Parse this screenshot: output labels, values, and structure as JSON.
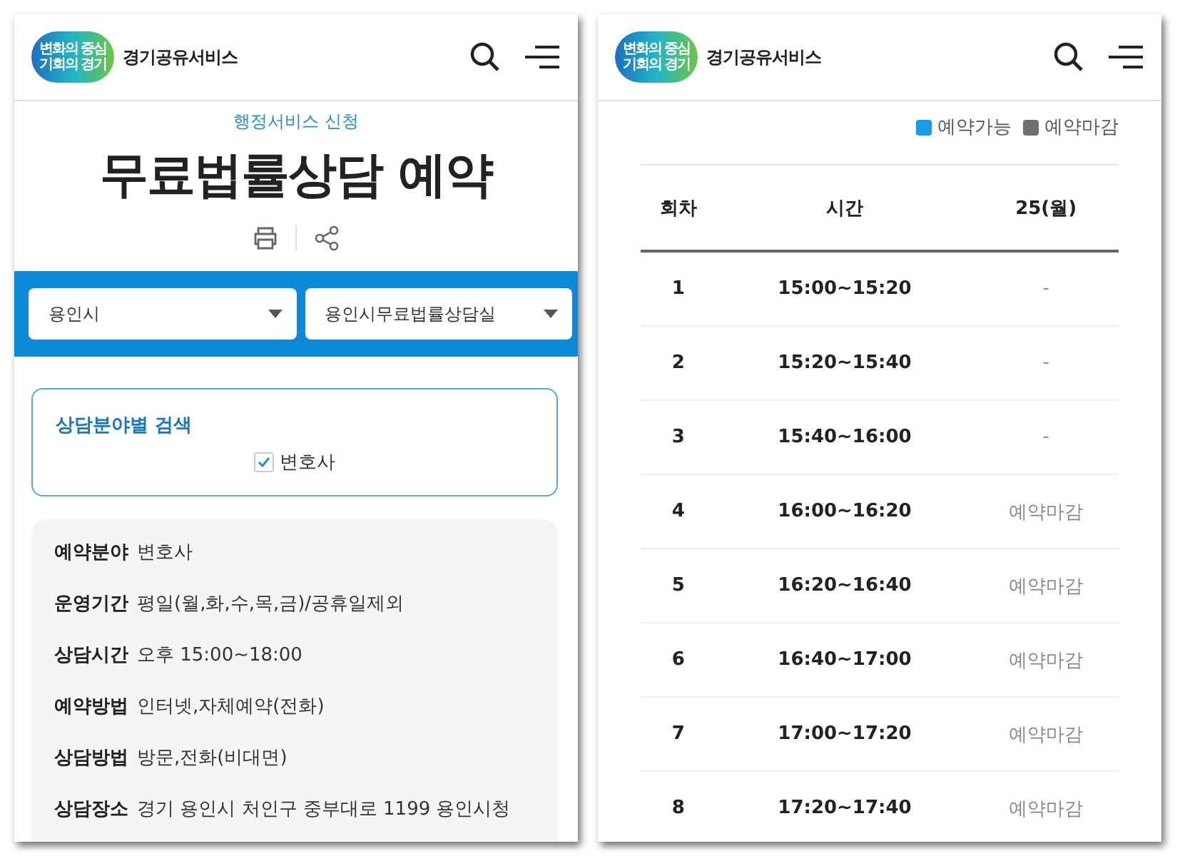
{
  "left_screen": {
    "header": {
      "logo_text": [
        "변화의 중심",
        "기회의 경기"
      ],
      "site_name": "경기공유서비스"
    },
    "category": "행정서비스 신청",
    "title": "무료법률상담 예약",
    "filters": [
      {
        "value": "용인시"
      },
      {
        "value": "용인시무료법률상담실"
      }
    ],
    "field_search": {
      "title": "상담분야별 검색",
      "options": [
        {
          "label": "변호사",
          "checked": true
        }
      ]
    },
    "details": [
      {
        "label": "예약분야",
        "value": "변호사"
      },
      {
        "label": "운영기간",
        "value": "평일(월,화,수,목,금)/공휴일제외"
      },
      {
        "label": "상담시간",
        "value": "오후 15:00~18:00"
      },
      {
        "label": "예약방법",
        "value": "인터넷,자체예약(전화)"
      },
      {
        "label": "상담방법",
        "value": "방문,전화(비대면)"
      },
      {
        "label": "상담장소",
        "value": "경기 용인시 처인구 중부대로 1199  용인시청"
      }
    ]
  },
  "right_screen": {
    "header": {
      "logo_text": [
        "변화의 중심",
        "기회의 경기"
      ],
      "site_name": "경기공유서비스"
    },
    "legend": [
      {
        "label": "예약가능",
        "color": "#1a9be6"
      },
      {
        "label": "예약마감",
        "color": "#707070"
      }
    ],
    "table": {
      "columns": [
        "회차",
        "시간",
        "25(월)"
      ],
      "rows": [
        {
          "cells": [
            "1",
            "15:00~15:20",
            "-"
          ]
        },
        {
          "cells": [
            "2",
            "15:20~15:40",
            "-"
          ]
        },
        {
          "cells": [
            "3",
            "15:40~16:00",
            "-"
          ]
        },
        {
          "cells": [
            "4",
            "16:00~16:20",
            "예약마감"
          ]
        },
        {
          "cells": [
            "5",
            "16:20~16:40",
            "예약마감"
          ]
        },
        {
          "cells": [
            "6",
            "16:40~17:00",
            "예약마감"
          ]
        },
        {
          "cells": [
            "7",
            "17:00~17:20",
            "예약마감"
          ]
        },
        {
          "cells": [
            "8",
            "17:20~17:40",
            "예약마감"
          ]
        }
      ]
    }
  }
}
